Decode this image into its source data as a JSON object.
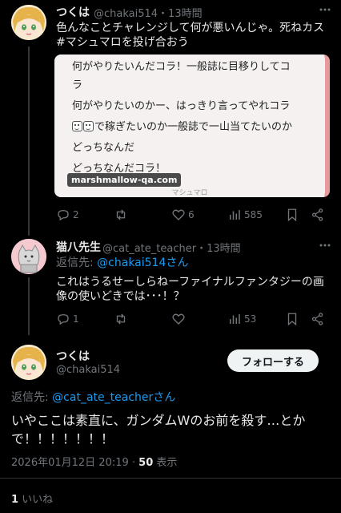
{
  "tweet1": {
    "name": "つくは",
    "handle": "@chakai514",
    "time": "・13時間",
    "text": "色んなことチャレンジして何が悪いんじゃ。死ねカス",
    "hashtag": "#マシュマロを投げ合おう",
    "card": {
      "lines": [
        "何がやりたいんだコラ！一般誌に目移りしてコ",
        "ラ",
        "何がやりたいのかー、はっきり言ってやれコラ",
        "で稼ぎたいのか一般誌で一山当てたいのか",
        "どっちなんだ",
        "どっちなんだコラ！"
      ],
      "domain": "marshmallow-qa.com",
      "brand": "マシュマロ"
    },
    "replies": "2",
    "likes": "6",
    "views": "585"
  },
  "tweet2": {
    "name": "猫八先生",
    "handle": "@cat_ate_teacher",
    "time": "・13時間",
    "reply_prefix": "返信先: ",
    "reply_to": "@chakai514さん",
    "text_line1": "これはうるせーしらねーファイナルファンタジーの画",
    "text_line2": "像の使いどきでは･･･！？",
    "replies": "1",
    "views": "53"
  },
  "main_tweet": {
    "name": "つくは",
    "handle": "@chakai514",
    "follow_label": "フォローする",
    "reply_prefix": "返信先: ",
    "reply_to": "@cat_ate_teacherさん",
    "text_line1": "いやここは素直に、ガンダムWのお前を殺す…とか",
    "text_line2": "で！！！！！！！",
    "timestamp": "2026年01月12日 20:19",
    "dot": " · ",
    "views_count": "50",
    "views_label": " 表示",
    "likes_count": "1",
    "likes_label": " いいね"
  },
  "colors": {
    "background": "#000000",
    "link": "#1d9bf0",
    "muted": "#71767b",
    "card_border": "#e59a9c"
  }
}
